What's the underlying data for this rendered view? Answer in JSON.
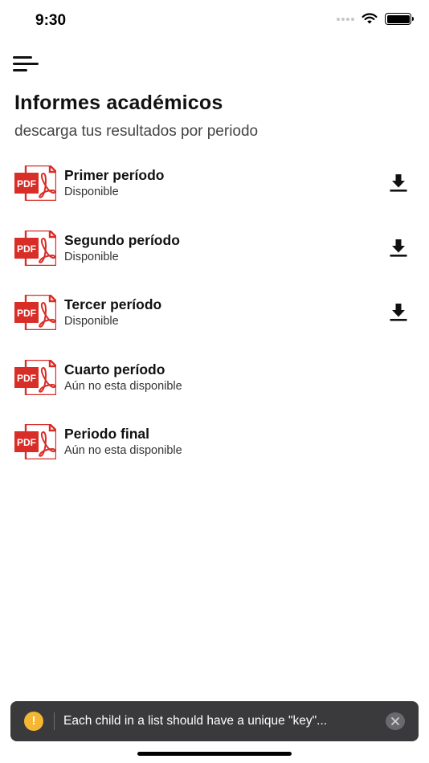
{
  "status_bar": {
    "time": "9:30"
  },
  "header": {
    "title": "Informes académicos",
    "subtitle": "descarga tus resultados por periodo"
  },
  "reports": [
    {
      "title": "Primer período",
      "status": "Disponible",
      "downloadable": true,
      "icon": "pdf-icon"
    },
    {
      "title": "Segundo período",
      "status": "Disponible",
      "downloadable": true,
      "icon": "pdf-icon"
    },
    {
      "title": "Tercer período",
      "status": "Disponible",
      "downloadable": true,
      "icon": "pdf-icon"
    },
    {
      "title": "Cuarto período",
      "status": "Aún no esta disponible",
      "downloadable": false,
      "icon": "pdf-icon"
    },
    {
      "title": "Periodo final",
      "status": "Aún no esta disponible",
      "downloadable": false,
      "icon": "pdf-icon"
    }
  ],
  "pdf_label": "PDF",
  "toast": {
    "icon": "warning-icon",
    "icon_glyph": "!",
    "message": "Each child in a list should have a unique \"key\"..."
  },
  "colors": {
    "pdf_red": "#d92d27",
    "toast_bg": "#3a3a3c",
    "warning": "#f5b731"
  }
}
